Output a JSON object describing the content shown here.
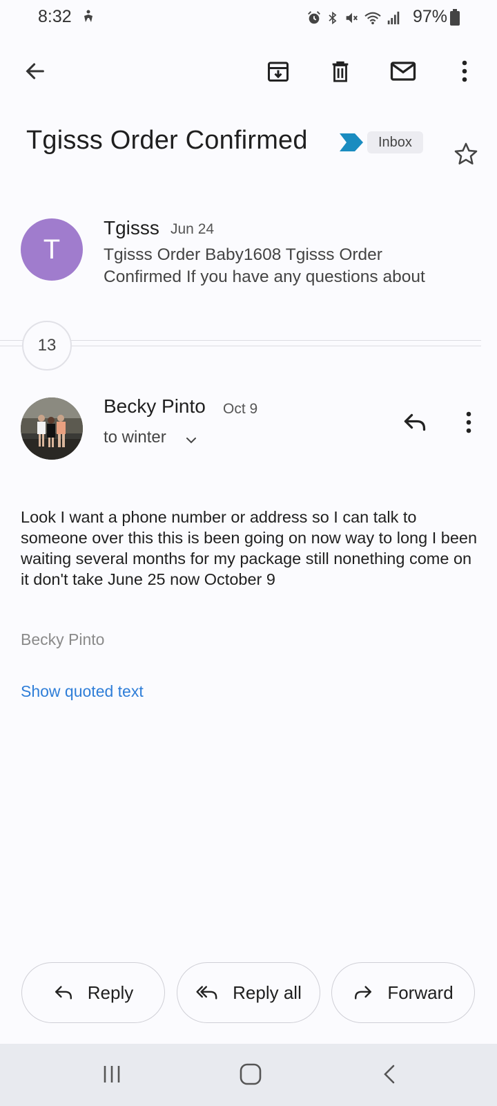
{
  "status_bar": {
    "time": "8:32",
    "battery": "97%",
    "icons": [
      "accessibility-icon",
      "alarm-icon",
      "bluetooth-icon",
      "vibrate-mute-icon",
      "wifi-icon",
      "signal-icon",
      "battery-icon"
    ]
  },
  "toolbar": {
    "back": "arrow-back-icon",
    "archive": "archive-icon",
    "delete": "trash-icon",
    "mark_unread": "mail-icon",
    "more": "more-vert-icon"
  },
  "thread": {
    "subject": "Tgisss Order Confirmed",
    "label": "Inbox",
    "starred": false
  },
  "messages": [
    {
      "avatar_letter": "T",
      "avatar_color": "#a07ccd",
      "sender": "Tgisss",
      "date": "Jun 24",
      "snippet": "Tgisss Order Baby1608 Tgisss Order Confirmed If you have any questions about"
    }
  ],
  "collapsed_count": "13",
  "open_message": {
    "sender": "Becky Pinto",
    "date": "Oct 9",
    "to": "to winter",
    "body": "Look I want a phone number or address so I can talk to someone over this this is been going on now way to long I been waiting several months for my package still nonething come on it don't take June 25 now October 9",
    "signature": "Becky Pinto",
    "show_quoted": "Show quoted text"
  },
  "actions": {
    "reply": "Reply",
    "reply_all": "Reply all",
    "forward": "Forward"
  },
  "colors": {
    "background": "#fbfbfe",
    "link": "#2f7ed8",
    "important": "#1a8cc0",
    "navbar": "#e8eaef"
  }
}
